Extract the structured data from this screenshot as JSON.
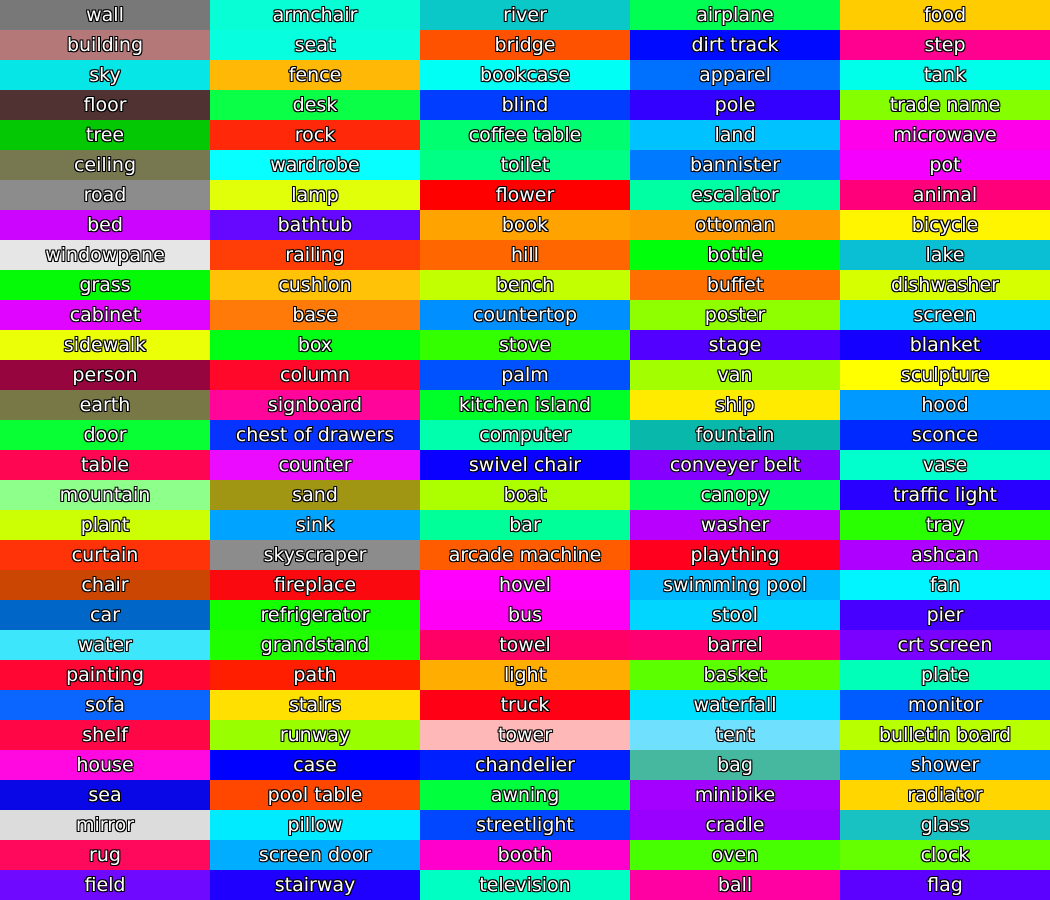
{
  "legend": {
    "items": [
      {
        "label": "wall",
        "color": "#787878"
      },
      {
        "label": "building",
        "color": "#b47878"
      },
      {
        "label": "sky",
        "color": "#06e6e6"
      },
      {
        "label": "floor",
        "color": "#503232"
      },
      {
        "label": "tree",
        "color": "#04c803"
      },
      {
        "label": "ceiling",
        "color": "#787850"
      },
      {
        "label": "road",
        "color": "#8c8c8c"
      },
      {
        "label": "bed",
        "color": "#cc05ff"
      },
      {
        "label": "windowpane",
        "color": "#e6e6e6"
      },
      {
        "label": "grass",
        "color": "#04fa07"
      },
      {
        "label": "cabinet",
        "color": "#e005ff"
      },
      {
        "label": "sidewalk",
        "color": "#ebff07"
      },
      {
        "label": "person",
        "color": "#96053d"
      },
      {
        "label": "earth",
        "color": "#787846"
      },
      {
        "label": "door",
        "color": "#08ff33"
      },
      {
        "label": "table",
        "color": "#ff0652"
      },
      {
        "label": "mountain",
        "color": "#8fff8c"
      },
      {
        "label": "plant",
        "color": "#ccff04"
      },
      {
        "label": "curtain",
        "color": "#ff3307"
      },
      {
        "label": "chair",
        "color": "#cc4603"
      },
      {
        "label": "car",
        "color": "#0066c8"
      },
      {
        "label": "water",
        "color": "#3de6fa"
      },
      {
        "label": "painting",
        "color": "#ff0633"
      },
      {
        "label": "sofa",
        "color": "#0b66ff"
      },
      {
        "label": "shelf",
        "color": "#ff0747"
      },
      {
        "label": "house",
        "color": "#ff09e0"
      },
      {
        "label": "sea",
        "color": "#0907e6"
      },
      {
        "label": "mirror",
        "color": "#dcdcdc"
      },
      {
        "label": "rug",
        "color": "#ff095c"
      },
      {
        "label": "field",
        "color": "#7009ff"
      },
      {
        "label": "armchair",
        "color": "#08ffd6"
      },
      {
        "label": "seat",
        "color": "#07ffe0"
      },
      {
        "label": "fence",
        "color": "#ffb806"
      },
      {
        "label": "desk",
        "color": "#0aff47"
      },
      {
        "label": "rock",
        "color": "#ff290a"
      },
      {
        "label": "wardrobe",
        "color": "#07ffff"
      },
      {
        "label": "lamp",
        "color": "#e0ff08"
      },
      {
        "label": "bathtub",
        "color": "#6608ff"
      },
      {
        "label": "railing",
        "color": "#ff3d06"
      },
      {
        "label": "cushion",
        "color": "#ffc207"
      },
      {
        "label": "base",
        "color": "#ff7a08"
      },
      {
        "label": "box",
        "color": "#00ff14"
      },
      {
        "label": "column",
        "color": "#ff0829"
      },
      {
        "label": "signboard",
        "color": "#ff0599"
      },
      {
        "label": "chest of drawers",
        "color": "#0633ff"
      },
      {
        "label": "counter",
        "color": "#eb0cff"
      },
      {
        "label": "sand",
        "color": "#a09614"
      },
      {
        "label": "sink",
        "color": "#00a3ff"
      },
      {
        "label": "skyscraper",
        "color": "#8c8c8c"
      },
      {
        "label": "fireplace",
        "color": "#fa0a0f"
      },
      {
        "label": "refrigerator",
        "color": "#14ff00"
      },
      {
        "label": "grandstand",
        "color": "#1fff00"
      },
      {
        "label": "path",
        "color": "#ff1f00"
      },
      {
        "label": "stairs",
        "color": "#ffe000"
      },
      {
        "label": "runway",
        "color": "#99ff00"
      },
      {
        "label": "case",
        "color": "#0000ff"
      },
      {
        "label": "pool table",
        "color": "#ff4700"
      },
      {
        "label": "pillow",
        "color": "#00ebff"
      },
      {
        "label": "screen door",
        "color": "#00adff"
      },
      {
        "label": "stairway",
        "color": "#1f00ff"
      },
      {
        "label": "river",
        "color": "#0bc8c8"
      },
      {
        "label": "bridge",
        "color": "#ff5200"
      },
      {
        "label": "bookcase",
        "color": "#00fff5"
      },
      {
        "label": "blind",
        "color": "#003dff"
      },
      {
        "label": "coffee table",
        "color": "#00ff70"
      },
      {
        "label": "toilet",
        "color": "#00ff85"
      },
      {
        "label": "flower",
        "color": "#ff0000"
      },
      {
        "label": "book",
        "color": "#ffa300"
      },
      {
        "label": "hill",
        "color": "#ff6600"
      },
      {
        "label": "bench",
        "color": "#c2ff00"
      },
      {
        "label": "countertop",
        "color": "#008fff"
      },
      {
        "label": "stove",
        "color": "#33ff00"
      },
      {
        "label": "palm",
        "color": "#0052ff"
      },
      {
        "label": "kitchen island",
        "color": "#00ff29"
      },
      {
        "label": "computer",
        "color": "#00ffad"
      },
      {
        "label": "swivel chair",
        "color": "#0a00ff"
      },
      {
        "label": "boat",
        "color": "#adff00"
      },
      {
        "label": "bar",
        "color": "#00ff99"
      },
      {
        "label": "arcade machine",
        "color": "#ff5c00"
      },
      {
        "label": "hovel",
        "color": "#ff00ff"
      },
      {
        "label": "bus",
        "color": "#ff00f5"
      },
      {
        "label": "towel",
        "color": "#ff0066"
      },
      {
        "label": "light",
        "color": "#ffad00"
      },
      {
        "label": "truck",
        "color": "#ff0014"
      },
      {
        "label": "tower",
        "color": "#ffb8b8"
      },
      {
        "label": "chandelier",
        "color": "#001fff"
      },
      {
        "label": "awning",
        "color": "#00ff3d"
      },
      {
        "label": "streetlight",
        "color": "#0047ff"
      },
      {
        "label": "booth",
        "color": "#ff00cc"
      },
      {
        "label": "television",
        "color": "#00ffc2"
      },
      {
        "label": "airplane",
        "color": "#00ff52"
      },
      {
        "label": "dirt track",
        "color": "#000aff"
      },
      {
        "label": "apparel",
        "color": "#0070ff"
      },
      {
        "label": "pole",
        "color": "#3300ff"
      },
      {
        "label": "land",
        "color": "#00c2ff"
      },
      {
        "label": "bannister",
        "color": "#007aff"
      },
      {
        "label": "escalator",
        "color": "#00ffa3"
      },
      {
        "label": "ottoman",
        "color": "#ff9900"
      },
      {
        "label": "bottle",
        "color": "#00ff0a"
      },
      {
        "label": "buffet",
        "color": "#ff7000"
      },
      {
        "label": "poster",
        "color": "#8fff00"
      },
      {
        "label": "stage",
        "color": "#5200ff"
      },
      {
        "label": "van",
        "color": "#a3ff00"
      },
      {
        "label": "ship",
        "color": "#ffeb00"
      },
      {
        "label": "fountain",
        "color": "#08b8aa"
      },
      {
        "label": "conveyer belt",
        "color": "#8500ff"
      },
      {
        "label": "canopy",
        "color": "#00ff5c"
      },
      {
        "label": "washer",
        "color": "#b800ff"
      },
      {
        "label": "plaything",
        "color": "#ff001f"
      },
      {
        "label": "swimming pool",
        "color": "#00b8ff"
      },
      {
        "label": "stool",
        "color": "#00d6ff"
      },
      {
        "label": "barrel",
        "color": "#ff0070"
      },
      {
        "label": "basket",
        "color": "#5cff00"
      },
      {
        "label": "waterfall",
        "color": "#00e0ff"
      },
      {
        "label": "tent",
        "color": "#70e0ff"
      },
      {
        "label": "bag",
        "color": "#46b8a0"
      },
      {
        "label": "minibike",
        "color": "#a300ff"
      },
      {
        "label": "cradle",
        "color": "#9900ff"
      },
      {
        "label": "oven",
        "color": "#47ff00"
      },
      {
        "label": "ball",
        "color": "#ff00a3"
      },
      {
        "label": "food",
        "color": "#ffcc00"
      },
      {
        "label": "step",
        "color": "#ff008f"
      },
      {
        "label": "tank",
        "color": "#00ffeb"
      },
      {
        "label": "trade name",
        "color": "#85ff00"
      },
      {
        "label": "microwave",
        "color": "#ff00eb"
      },
      {
        "label": "pot",
        "color": "#f500ff"
      },
      {
        "label": "animal",
        "color": "#ff007a"
      },
      {
        "label": "bicycle",
        "color": "#fff500"
      },
      {
        "label": "lake",
        "color": "#0abed4"
      },
      {
        "label": "dishwasher",
        "color": "#d6ff00"
      },
      {
        "label": "screen",
        "color": "#00ccff"
      },
      {
        "label": "blanket",
        "color": "#1400ff"
      },
      {
        "label": "sculpture",
        "color": "#ffff00"
      },
      {
        "label": "hood",
        "color": "#0099ff"
      },
      {
        "label": "sconce",
        "color": "#0029ff"
      },
      {
        "label": "vase",
        "color": "#00ffcc"
      },
      {
        "label": "traffic light",
        "color": "#2900ff"
      },
      {
        "label": "tray",
        "color": "#29ff00"
      },
      {
        "label": "ashcan",
        "color": "#ad00ff"
      },
      {
        "label": "fan",
        "color": "#00f5ff"
      },
      {
        "label": "pier",
        "color": "#4700ff"
      },
      {
        "label": "crt screen",
        "color": "#7a00ff"
      },
      {
        "label": "plate",
        "color": "#00ffb8"
      },
      {
        "label": "monitor",
        "color": "#005cff"
      },
      {
        "label": "bulletin board",
        "color": "#b8ff00"
      },
      {
        "label": "shower",
        "color": "#0085ff"
      },
      {
        "label": "radiator",
        "color": "#ffd600"
      },
      {
        "label": "glass",
        "color": "#19c2c2"
      },
      {
        "label": "clock",
        "color": "#66ff00"
      },
      {
        "label": "flag",
        "color": "#5c00ff"
      }
    ]
  }
}
